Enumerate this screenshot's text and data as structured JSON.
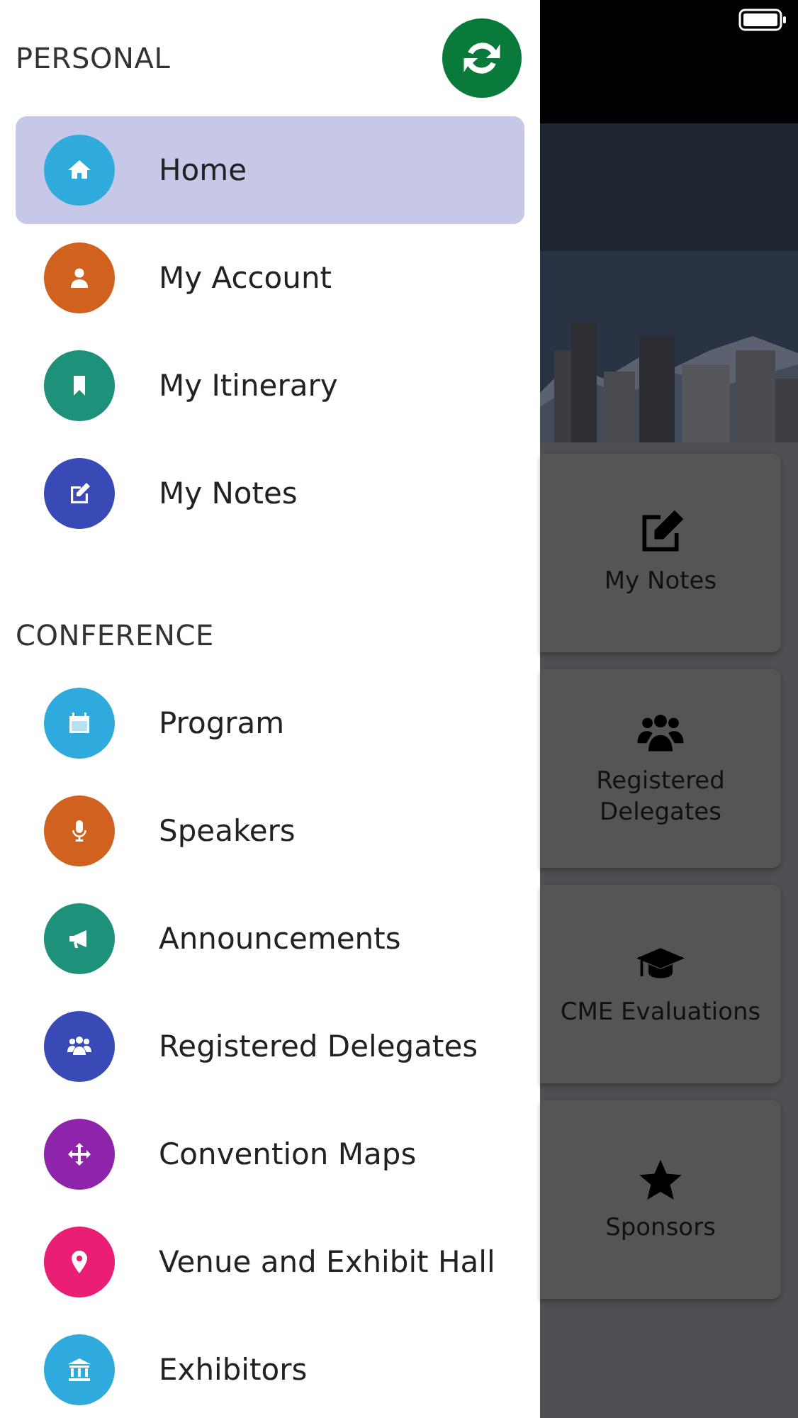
{
  "drawer": {
    "sections": [
      {
        "title": "PERSONAL",
        "items": [
          {
            "label": "Home",
            "color": "#2eaadc",
            "selected": true
          },
          {
            "label": "My Account",
            "color": "#d0611e",
            "selected": false
          },
          {
            "label": "My Itinerary",
            "color": "#1e917a",
            "selected": false
          },
          {
            "label": "My Notes",
            "color": "#3949b5",
            "selected": false
          }
        ]
      },
      {
        "title": "CONFERENCE",
        "items": [
          {
            "label": "Program",
            "color": "#2eaadc",
            "selected": false
          },
          {
            "label": "Speakers",
            "color": "#d0611e",
            "selected": false
          },
          {
            "label": "Announcements",
            "color": "#1e917a",
            "selected": false
          },
          {
            "label": "Registered Delegates",
            "color": "#3949b5",
            "selected": false
          },
          {
            "label": "Convention Maps",
            "color": "#8e24aa",
            "selected": false
          },
          {
            "label": "Venue and Exhibit Hall",
            "color": "#e91e74",
            "selected": false
          },
          {
            "label": "Exhibitors",
            "color": "#2eaadc",
            "selected": false
          }
        ]
      }
    ]
  },
  "tiles": [
    {
      "label": "My Notes"
    },
    {
      "label": "Registered Delegates"
    },
    {
      "label": "CME Evaluations"
    },
    {
      "label": "Sponsors"
    }
  ]
}
